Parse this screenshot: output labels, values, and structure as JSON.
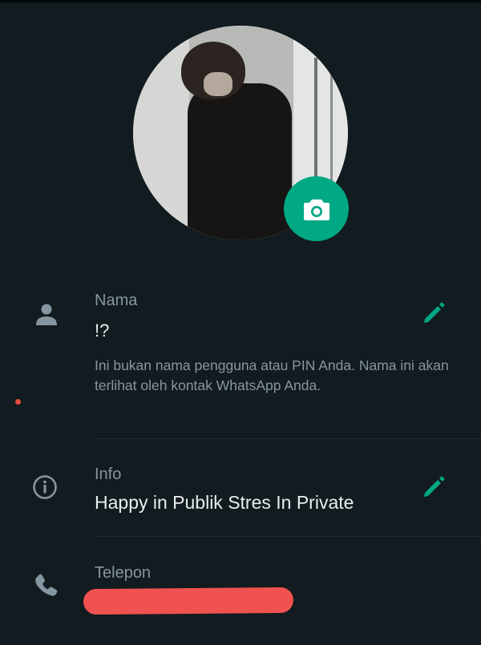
{
  "profile": {
    "name_label": "Nama",
    "name_value": "!?",
    "name_hint": "Ini bukan nama pengguna atau PIN Anda. Nama ini akan terlihat oleh kontak WhatsApp Anda.",
    "info_label": "Info",
    "info_value": "Happy in Publik Stres In Private",
    "phone_label": "Telepon",
    "phone_value": ""
  },
  "icons": {
    "camera": "camera-icon",
    "person": "person-icon",
    "info": "info-icon",
    "phone": "phone-icon",
    "edit": "pencil-icon"
  },
  "colors": {
    "background": "#121b1f",
    "accent": "#00a884",
    "secondary_text": "#8696a0",
    "primary_text": "#e9edef",
    "redaction": "#f0524f"
  }
}
